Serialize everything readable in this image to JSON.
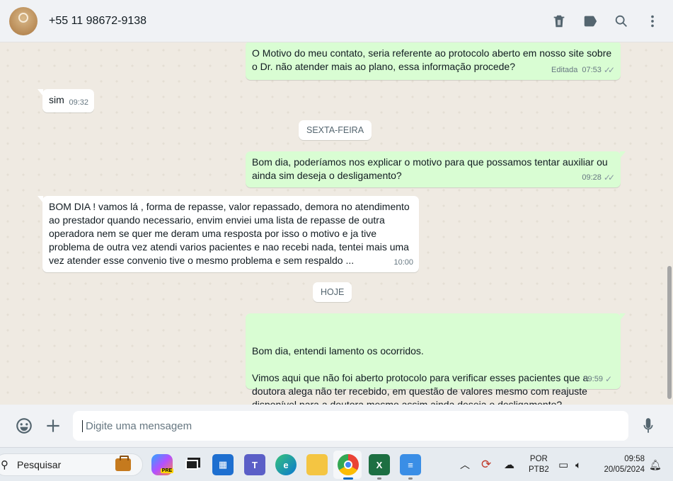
{
  "header": {
    "contact": "+55 11 98672-9138",
    "icons": [
      "trash-icon",
      "label-icon",
      "search-icon",
      "more-icon"
    ]
  },
  "messages": [
    {
      "dir": "out",
      "text": "O Motivo do meu contato, seria referente ao protocolo aberto em nosso site sobre o Dr. não atender mais ao plano, essa informação procede?",
      "edited": "Editada",
      "time": "07:53"
    },
    {
      "dir": "in",
      "text": "sim",
      "time": "09:32"
    },
    {
      "dir": "out",
      "text": "Bom dia, poderíamos nos explicar o motivo para que possamos tentar auxiliar ou ainda sim deseja o desligamento?",
      "time": "09:28"
    },
    {
      "dir": "in",
      "text": "BOM DIA ! vamos lá , forma de repasse, valor repassado, demora no atendimento ao prestador quando necessario, envim enviei uma lista de repasse de outra operadora nem se quer me deram uma resposta por isso o motivo e ja tive problema de outra vez atendi varios pacientes e nao recebi nada, tentei mais uma vez atender esse convenio tive o mesmo problema e sem respaldo ...",
      "time": "10:00"
    },
    {
      "dir": "out",
      "text": "Bom dia, entendi lamento os ocorridos.\n\nVimos aqui que não foi aberto protocolo para verificar esses pacientes que a doutora alega não ter recebido, em questão de valores mesmo com reajuste disponível para a doutora mesmo assim ainda deseja o desligamento?",
      "time": "09:59"
    }
  ],
  "dividers": {
    "friday": "SEXTA-FEIRA",
    "today": "HOJE"
  },
  "composer": {
    "placeholder": "Digite uma mensagem"
  },
  "taskbar": {
    "search": "Pesquisar",
    "lang_line1": "POR",
    "lang_line2": "PTB2",
    "time": "09:58",
    "date": "20/05/2024",
    "copilot_badge": "PRE"
  },
  "colors": {
    "outgoing_bubble": "#d9fdd3",
    "incoming_bubble": "#ffffff",
    "chat_background": "#efeae2"
  }
}
